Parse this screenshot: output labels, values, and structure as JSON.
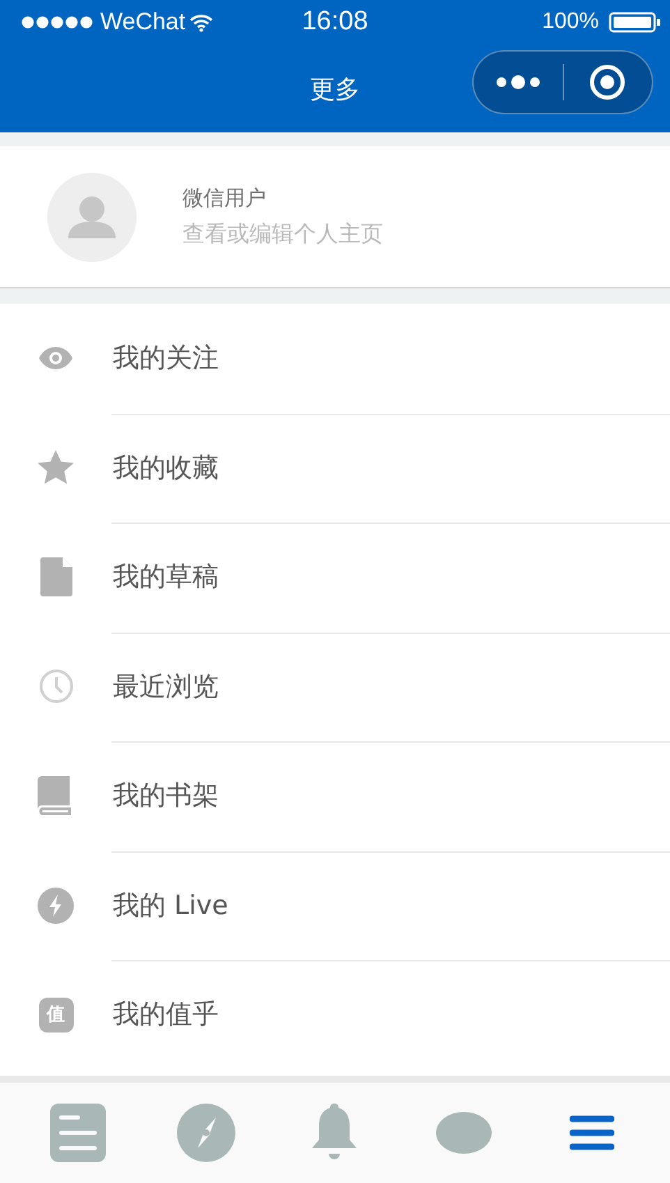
{
  "status_bar": {
    "carrier": "WeChat",
    "time": "16:08",
    "battery": "100%"
  },
  "nav": {
    "title": "更多"
  },
  "profile": {
    "name": "微信用户",
    "subtitle": "查看或编辑个人主页"
  },
  "menu": [
    {
      "kind": "eye",
      "label": "我的关注"
    },
    {
      "kind": "star",
      "label": "我的收藏"
    },
    {
      "kind": "file",
      "label": "我的草稿"
    },
    {
      "kind": "clock",
      "label": "最近浏览"
    },
    {
      "kind": "book",
      "label": "我的书架"
    },
    {
      "kind": "bolt",
      "label": "我的 Live"
    },
    {
      "kind": "zhi",
      "label": "我的值乎",
      "icon_text": "值"
    }
  ],
  "tab_bar": [
    {
      "kind": "feed",
      "selected": false
    },
    {
      "kind": "compass",
      "selected": false
    },
    {
      "kind": "bell",
      "selected": false
    },
    {
      "kind": "chat",
      "selected": false
    },
    {
      "kind": "more",
      "selected": true
    }
  ]
}
